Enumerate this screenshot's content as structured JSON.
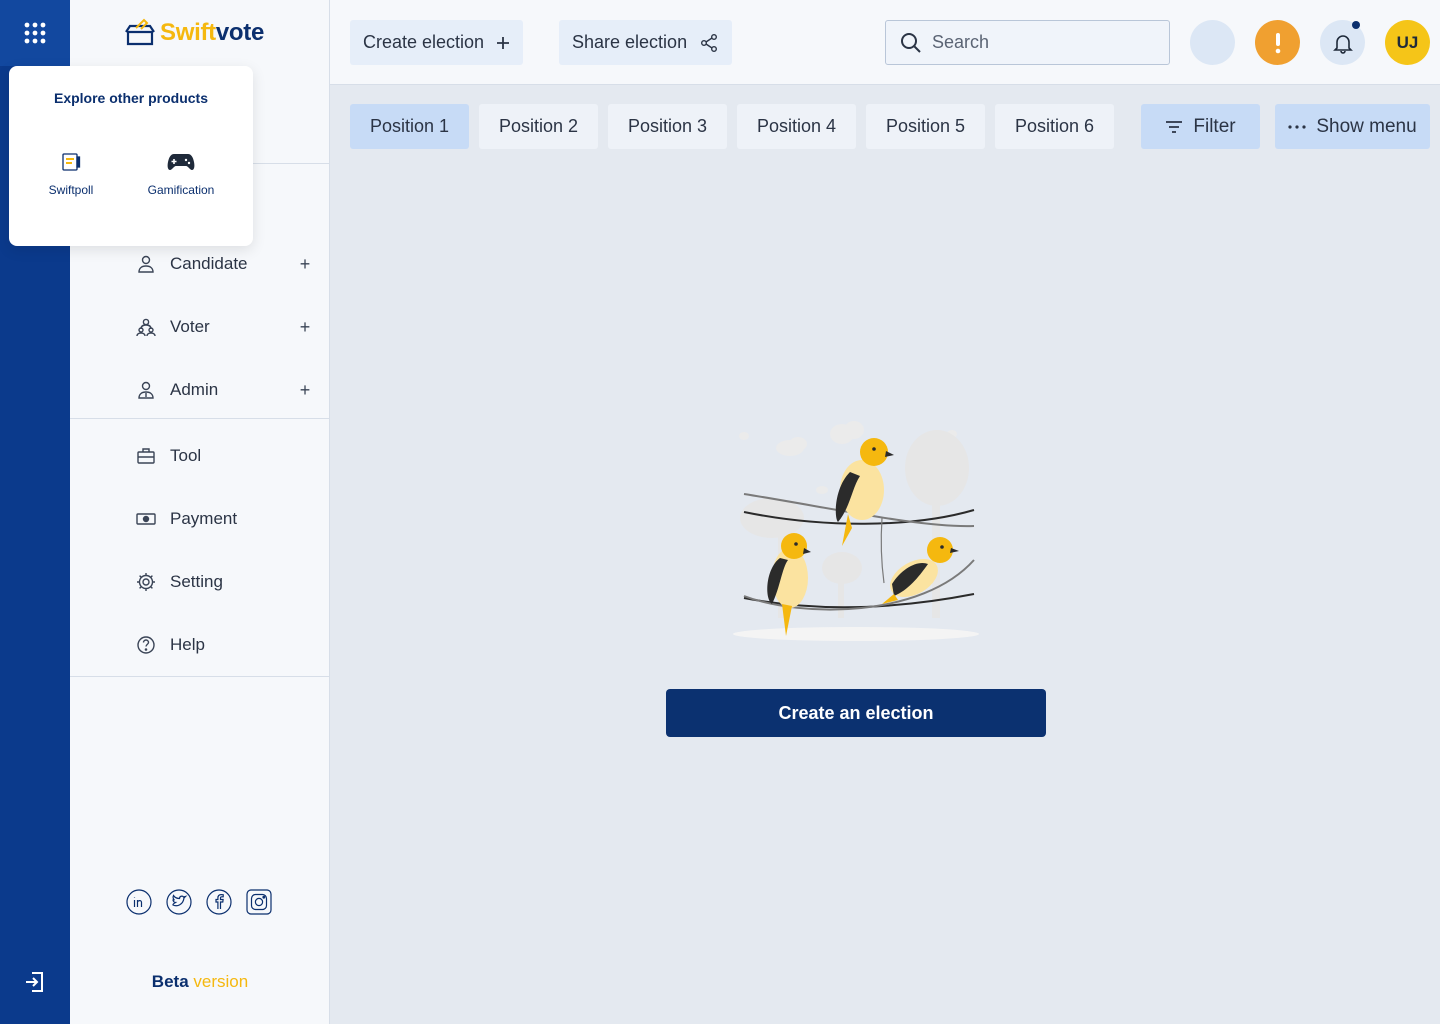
{
  "app": {
    "brand_part1": "Swift",
    "brand_part2": "vote"
  },
  "popup": {
    "title": "Explore other products",
    "products": [
      {
        "label": "Swiftpoll",
        "icon": "poll-icon"
      },
      {
        "label": "Gamification",
        "icon": "gamepad-icon"
      }
    ]
  },
  "sidebar": {
    "items": [
      {
        "label": "Candidate",
        "icon": "person-icon",
        "expandable": true
      },
      {
        "label": "Voter",
        "icon": "voters-icon",
        "expandable": true
      },
      {
        "label": "Admin",
        "icon": "admin-icon",
        "expandable": true
      },
      {
        "label": "Tool",
        "icon": "toolbox-icon",
        "expandable": false
      },
      {
        "label": "Payment",
        "icon": "payment-icon",
        "expandable": false
      },
      {
        "label": "Setting",
        "icon": "gear-icon",
        "expandable": false
      },
      {
        "label": "Help",
        "icon": "help-icon",
        "expandable": false
      }
    ],
    "socials": [
      "linkedin-icon",
      "twitter-icon",
      "facebook-icon",
      "instagram-icon"
    ],
    "beta_part1": "Beta",
    "beta_part2": "version"
  },
  "topbar": {
    "create_label": "Create election",
    "share_label": "Share election",
    "search_placeholder": "Search",
    "avatar_initials": "UJ"
  },
  "tabs": [
    "Position 1",
    "Position 2",
    "Position 3",
    "Position 4",
    "Position 5",
    "Position 6"
  ],
  "active_tab": 0,
  "actions": {
    "filter_label": "Filter",
    "menu_label": "Show menu"
  },
  "main": {
    "cta_label": "Create an election"
  },
  "colors": {
    "rail": "#0b3a8c",
    "brand_yellow": "#f5b80f",
    "brand_navy": "#0b2f6e",
    "cta": "#0b3170",
    "warning": "#f0a030",
    "avatar": "#f5c518"
  }
}
